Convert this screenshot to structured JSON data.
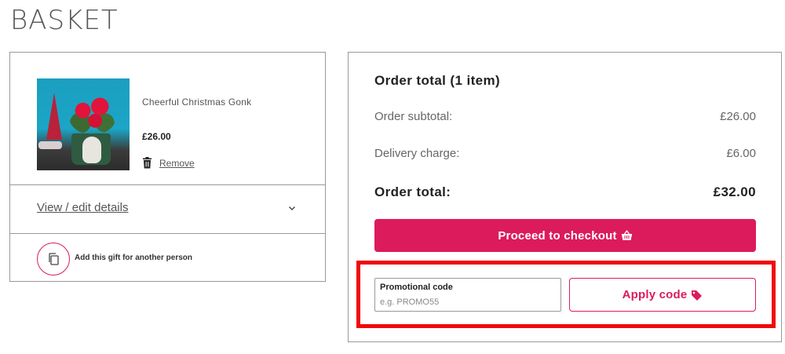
{
  "page": {
    "title": "BASKET"
  },
  "basket": {
    "item": {
      "name": "Cheerful Christmas Gonk",
      "price": "£26.00",
      "remove_label": "Remove"
    },
    "view_details_label": "View / edit details",
    "gift_label": "Add this gift for another person"
  },
  "summary": {
    "title": "Order total (1 item)",
    "subtotal_label": "Order subtotal:",
    "subtotal_value": "£26.00",
    "delivery_label": "Delivery charge:",
    "delivery_value": "£6.00",
    "total_label": "Order total:",
    "total_value": "£32.00",
    "checkout_label": "Proceed to checkout"
  },
  "promo": {
    "label": "Promotional code",
    "placeholder": "e.g. PROMO55",
    "value": "",
    "apply_label": "Apply code"
  },
  "icons": {
    "remove": "trash-icon",
    "view_details": "chevron-down-icon",
    "gift": "copy-icon",
    "checkout": "basket-icon",
    "apply": "tag-icon"
  },
  "colors": {
    "accent": "#dc1b5c",
    "highlight": "#f00a0a"
  }
}
